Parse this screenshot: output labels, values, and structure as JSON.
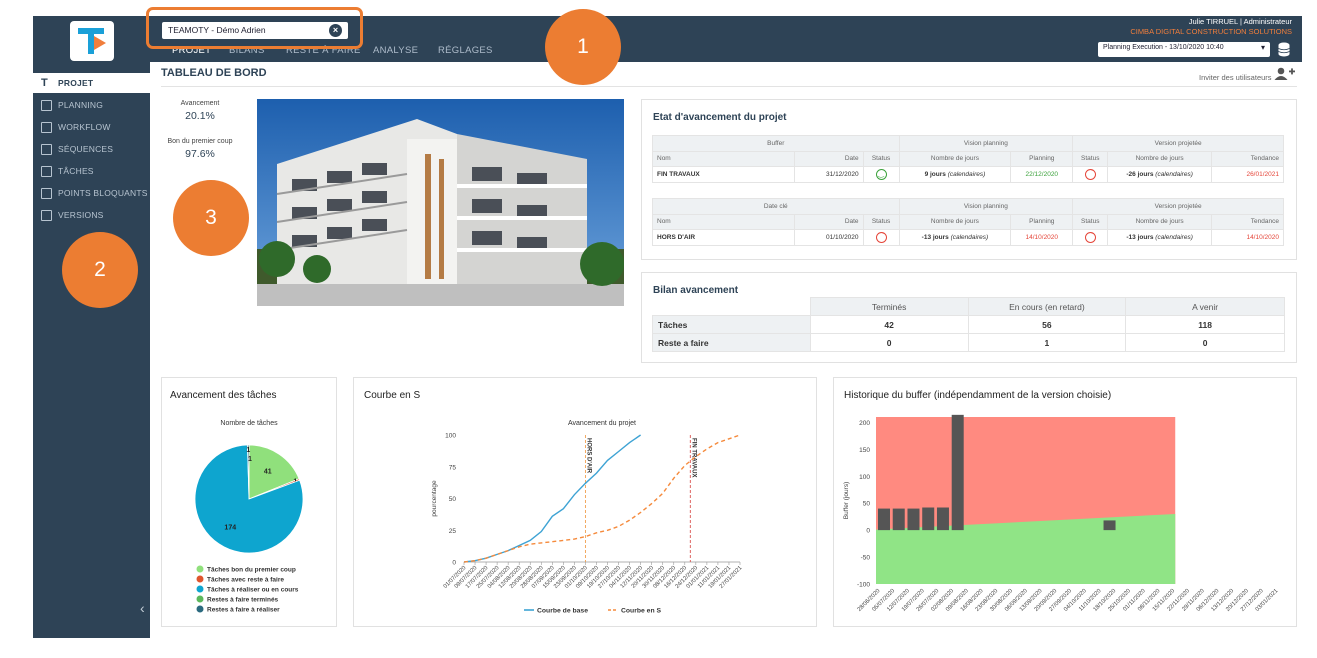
{
  "callouts": {
    "c1": "1",
    "c2": "2",
    "c3": "3"
  },
  "topbar": {
    "project": "TEAMOTY - Démo Adrien",
    "clear": "×",
    "tabs": [
      "PROJET",
      "BILANS",
      "RESTE À FAIRE",
      "ANALYSE",
      "RÉGLAGES"
    ],
    "user": "Julie TIRRUEL | Administrateur",
    "company": "CIMBA DIGITAL CONSTRUCTION SOLUTIONS",
    "planning": "Planning Execution - 13/10/2020 10:40"
  },
  "sidebar": {
    "items": [
      {
        "label": "PROJET",
        "icon": "teamoty-icon"
      },
      {
        "label": "PLANNING",
        "icon": "planning-icon"
      },
      {
        "label": "WORKFLOW",
        "icon": "workflow-icon"
      },
      {
        "label": "SÉQUENCES",
        "icon": "sequences-icon"
      },
      {
        "label": "TÂCHES",
        "icon": "tasks-icon"
      },
      {
        "label": "POINTS BLOQUANTS",
        "icon": "blocking-icon"
      },
      {
        "label": "VERSIONS",
        "icon": "versions-icon"
      }
    ],
    "collapse": "‹"
  },
  "page": {
    "title": "TABLEAU DE BORD",
    "invite": "Inviter des utilisateurs"
  },
  "kpis": {
    "avancement_label": "Avancement",
    "avancement_value": "20.1%",
    "bpc_label": "Bon du premier coup",
    "bpc_value": "97.6%"
  },
  "etat": {
    "title": "Etat d'avancement du projet",
    "h_buffer": "Buffer",
    "h_date_cle": "Date clé",
    "h_vision": "Vision planning",
    "h_version": "Version projetée",
    "cols": [
      "Nom",
      "Date",
      "Status",
      "Nombre de jours",
      "Planning",
      "Status",
      "Nombre de jours",
      "Tendance"
    ],
    "row1": {
      "nom": "FIN TRAVAUX",
      "date": "31/12/2020",
      "jours1": "9 jours",
      "cal": "(calendaires)",
      "planning": "22/12/2020",
      "jours2": "-26 jours",
      "tendance": "26/01/2021"
    },
    "row2": {
      "nom": "HORS D'AIR",
      "date": "01/10/2020",
      "jours1": "-13 jours",
      "planning": "14/10/2020",
      "jours2": "-13 jours",
      "tendance": "14/10/2020"
    }
  },
  "bilan": {
    "title": "Bilan avancement",
    "cols": [
      "Terminés",
      "En cours (en retard)",
      "A venir"
    ],
    "rows": [
      {
        "label": "Tâches",
        "values": [
          "42",
          "56",
          "118"
        ]
      },
      {
        "label": "Reste a faire",
        "values": [
          "0",
          "1",
          "0"
        ]
      }
    ]
  },
  "chart_data": [
    {
      "type": "pie",
      "panel_title": "Avancement des tâches",
      "title": "Nombre de tâches",
      "slices": [
        {
          "label": "Tâches bon du premier coup",
          "value": 41,
          "color": "#90e07c"
        },
        {
          "label": "Tâches avec reste à faire",
          "value": 1,
          "color": "#e0552d"
        },
        {
          "label": "Tâches à réaliser ou en cours",
          "value": 174,
          "color": "#0ea5cf"
        },
        {
          "label": "Restes à faire terminés",
          "value": 0,
          "color": "#5cb85c"
        },
        {
          "label": "Restes à faire à réaliser",
          "value": 1,
          "color": "#2b6a7f"
        }
      ],
      "extra_label": "1"
    },
    {
      "type": "line",
      "panel_title": "Courbe en S",
      "title": "Avancement du projet",
      "ylabel": "pourcentage",
      "ylim": [
        0,
        100
      ],
      "yticks": [
        0,
        25,
        50,
        75,
        100
      ],
      "x": [
        "01/07/2020",
        "09/07/2020",
        "17/07/2020",
        "25/07/2020",
        "04/08/2020",
        "12/08/2020",
        "20/08/2020",
        "28/08/2020",
        "07/09/2020",
        "15/09/2020",
        "23/09/2020",
        "01/10/2020",
        "09/10/2020",
        "19/10/2020",
        "27/10/2020",
        "04/11/2020",
        "12/11/2020",
        "20/11/2020",
        "30/11/2020",
        "08/12/2020",
        "16/12/2020",
        "24/12/2020",
        "01/01/2021",
        "11/01/2021",
        "19/01/2021",
        "27/01/2021"
      ],
      "series": [
        {
          "name": "Courbe de base",
          "color": "#3ea3d4",
          "dashed": false,
          "values": [
            0,
            1,
            3,
            6,
            9,
            13,
            17,
            24,
            36,
            42,
            53,
            62,
            70,
            80,
            87,
            94,
            100,
            null,
            null,
            null,
            null,
            null,
            null,
            null,
            null,
            null
          ]
        },
        {
          "name": "Courbe en S",
          "color": "#f58a3c",
          "dashed": true,
          "values": [
            0,
            1,
            3,
            6,
            9,
            12,
            14,
            15,
            16,
            17,
            18,
            20,
            23,
            25,
            28,
            33,
            39,
            46,
            54,
            66,
            76,
            83,
            89,
            94,
            97,
            100
          ]
        }
      ],
      "markers": [
        {
          "label": "HORS D'AIR",
          "x_index": 11,
          "color": "#f0a050"
        },
        {
          "label": "FIN TRAVAUX",
          "x_index": 20.5,
          "color": "#d9534f"
        }
      ]
    },
    {
      "type": "bar",
      "panel_title": "Historique du buffer (indépendamment de la version choisie)",
      "ylabel": "Buffer (jours)",
      "ylim": [
        -100,
        210
      ],
      "yticks": [
        -100,
        -50,
        0,
        50,
        100,
        150,
        200
      ],
      "x": [
        "28/06/2020",
        "05/07/2020",
        "12/07/2020",
        "19/07/2020",
        "26/07/2020",
        "02/08/2020",
        "09/08/2020",
        "16/08/2020",
        "23/08/2020",
        "30/08/2020",
        "06/09/2020",
        "13/09/2020",
        "20/09/2020",
        "27/09/2020",
        "04/10/2020",
        "11/10/2020",
        "18/10/2020",
        "25/10/2020",
        "01/11/2020",
        "08/11/2020",
        "15/11/2020",
        "22/11/2020",
        "29/11/2020",
        "06/12/2020",
        "13/12/2020",
        "20/12/2020",
        "27/12/2020",
        "03/01/2021"
      ],
      "bar_color": "#555555",
      "bars": [
        {
          "x_index": 0,
          "value": 40
        },
        {
          "x_index": 1,
          "value": 40
        },
        {
          "x_index": 2,
          "value": 40
        },
        {
          "x_index": 3,
          "value": 42
        },
        {
          "x_index": 4,
          "value": 42
        },
        {
          "x_index": 5,
          "value": 214
        },
        {
          "x_index": 15.3,
          "value": 18
        }
      ],
      "green_band_start": 1,
      "green_band_end": 30,
      "band_end_index": 20.3,
      "colors": {
        "red": "#ff8a80",
        "green": "#90e486"
      }
    }
  ]
}
